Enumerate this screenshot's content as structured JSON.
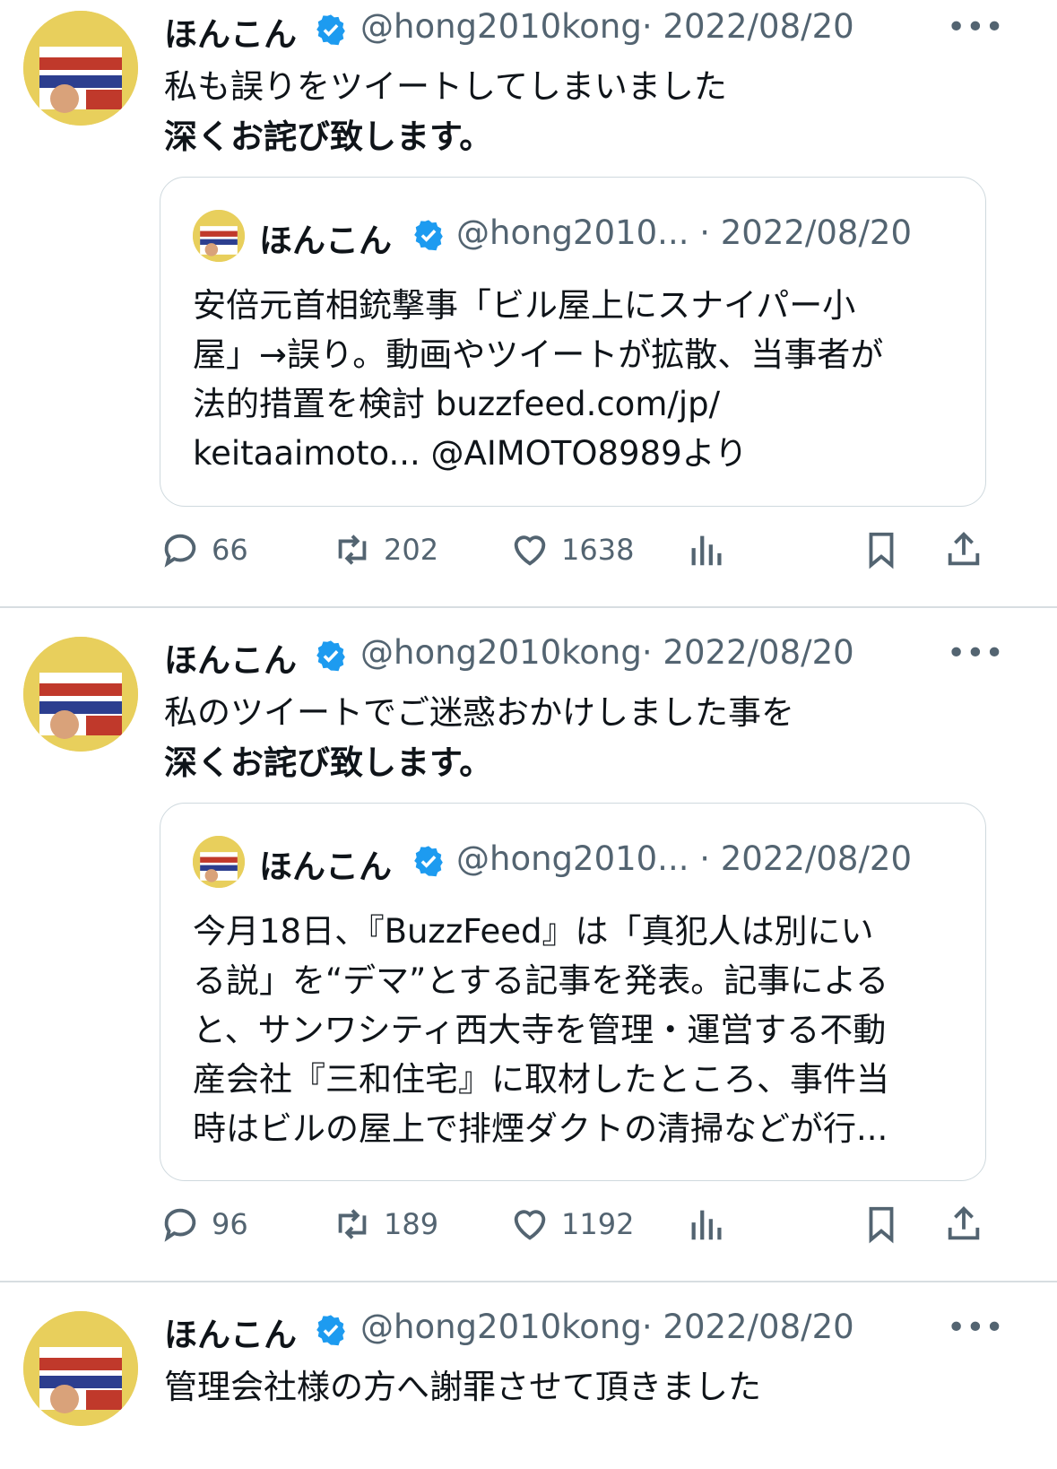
{
  "tweets": [
    {
      "name": "ほんこん",
      "handle": "@hong2010kong",
      "date": "· 2022/08/20",
      "more": "•••",
      "lines": [
        "私も誤りをツイートしてしまいました",
        "深くお詫び致します。"
      ],
      "quote": {
        "name": "ほんこん",
        "handle": "@hong2010... · 2022/08/20",
        "lines": [
          "安倍元首相銃撃事「ビル屋上にスナイパー小",
          "屋」→誤り。動画やツイートが拡散、当事者が",
          "法的措置を検討 buzzfeed.com/jp/",
          "keitaaimoto... @AIMOTO8989より"
        ]
      },
      "replies": "66",
      "retweets": "202",
      "likes": "1638"
    },
    {
      "name": "ほんこん",
      "handle": "@hong2010kong",
      "date": "· 2022/08/20",
      "more": "•••",
      "lines": [
        "私のツイートでご迷惑おかけしました事を",
        "深くお詫び致します。"
      ],
      "quote": {
        "name": "ほんこん",
        "handle": "@hong2010... · 2022/08/20",
        "lines": [
          "今月18日、『BuzzFeed』は「真犯人は別にい",
          "る説」を“デマ”とする記事を発表。記事による",
          "と、サンワシティ西大寺を管理・運営する不動",
          "産会社『三和住宅』に取材したところ、事件当",
          "時はビルの屋上で排煙ダクトの清掃などが行..."
        ]
      },
      "replies": "96",
      "retweets": "189",
      "likes": "1192"
    },
    {
      "name": "ほんこん",
      "handle": "@hong2010kong",
      "date": "· 2022/08/20",
      "more": "•••",
      "lines": [
        "管理会社様の方へ謝罪させて頂きました"
      ]
    }
  ],
  "icons": {
    "reply": "reply-icon",
    "retweet": "retweet-icon",
    "like": "heart-icon",
    "views": "views-icon",
    "bookmark": "bookmark-icon",
    "share": "share-icon",
    "verified": "verified-badge-icon",
    "more": "more-icon"
  },
  "colors": {
    "verified": "#1d9bf0",
    "muted": "#536471",
    "text": "#0f1419",
    "border": "#cfd9de"
  }
}
